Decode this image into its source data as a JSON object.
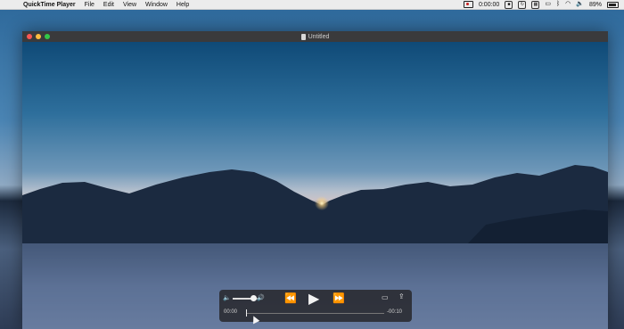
{
  "menubar": {
    "apple_icon": "apple-icon",
    "app_name": "QuickTime Player",
    "menus": [
      "File",
      "Edit",
      "View",
      "Window",
      "Help"
    ],
    "status": {
      "recording_time": "0:00:00",
      "battery_percent": "89%"
    }
  },
  "window": {
    "title": "Untitled"
  },
  "controls": {
    "elapsed": "00:00",
    "remaining": "-00:10",
    "volume_level": 0.75,
    "playback_progress": 0.0
  },
  "colors": {
    "traffic_red": "#fc5753",
    "traffic_yellow": "#fdbc40",
    "traffic_green": "#33c748",
    "hud_background": "#28282c"
  }
}
